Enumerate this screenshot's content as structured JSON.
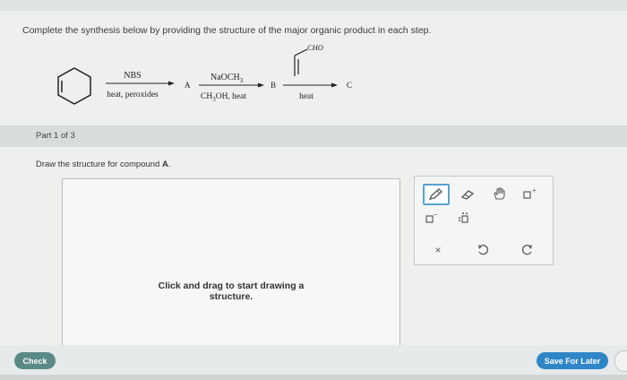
{
  "question": "Complete the synthesis below by providing the structure of the major organic product in each step.",
  "scheme": {
    "step1_above": "NBS",
    "step1_below": "heat, peroxides",
    "product_a": "A",
    "step2_above_main": "NaOCH",
    "step2_above_sub": "3",
    "step2_below_a": "CH",
    "step2_below_sub": "3",
    "step2_below_b": "OH, heat",
    "product_b": "B",
    "dienophile_label": "CHO",
    "step3_below": "heat",
    "product_c": "C"
  },
  "part_label": "Part 1 of 3",
  "instruction_prefix": "Draw the structure for compound ",
  "instruction_compound": "A",
  "instruction_suffix": ".",
  "canvas_hint_line1": "Click and drag to start drawing a",
  "canvas_hint_line2": "structure.",
  "toolbar": {
    "icons": [
      "pencil-icon",
      "eraser-icon",
      "hand-icon",
      "charge-plus-icon",
      "charge-minus-icon",
      "lone-pair-icon",
      "close-icon",
      "undo-icon",
      "redo-icon"
    ],
    "plus_mark": "+",
    "minus_mark": "−",
    "close_mark": "×"
  },
  "check_label": "Check",
  "save_label": "Save For Later",
  "colors": {
    "check": "#5a8a85",
    "save": "#2f86c6",
    "tool_active": "#5aa2cf"
  }
}
